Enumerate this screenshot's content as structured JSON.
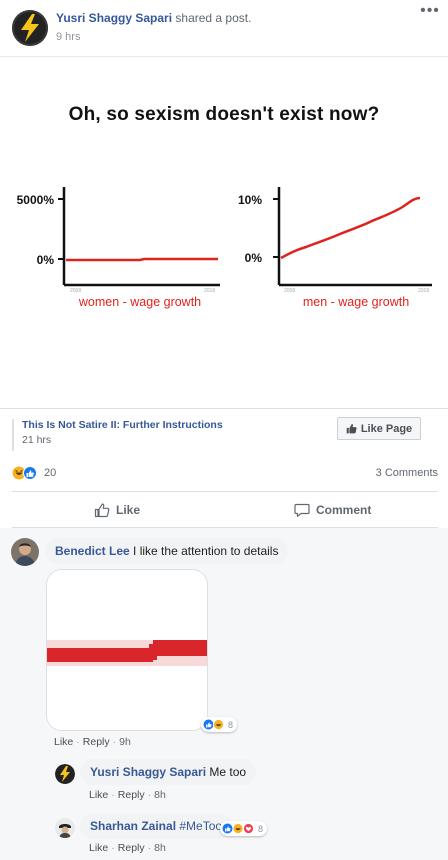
{
  "post": {
    "author": "Yusri Shaggy Sapari",
    "action": "shared a post.",
    "time": "9 hrs",
    "more_icon": "ellipsis-icon"
  },
  "meme": {
    "title": "Oh, so sexism doesn't exist now?",
    "left_chart": {
      "y_top_label": "5000%",
      "y_bottom_label": "0%",
      "x_start": "2008",
      "x_end": "2018",
      "caption": "women - wage growth",
      "line_color": "#e0221d"
    },
    "right_chart": {
      "y_top_label": "10%",
      "y_bottom_label": "0%",
      "x_start": "2008",
      "x_end": "2018",
      "caption": "men - wage growth",
      "line_color": "#e0221d"
    }
  },
  "shared_from": {
    "page_name": "This Is Not Satire II: Further Instructions",
    "time": "21 hrs",
    "like_page_label": "Like Page"
  },
  "reactions": {
    "count": "20",
    "comments_label": "3 Comments",
    "icons": [
      "haha-icon",
      "like-icon"
    ]
  },
  "actions": {
    "like_label": "Like",
    "comment_label": "Comment"
  },
  "comments": [
    {
      "name": "Benedict Lee",
      "text": "I like the attention to details",
      "reaction_count": "8",
      "like": "Like",
      "reply": "Reply",
      "time": "9h"
    },
    {
      "name": "Yusri Shaggy Sapari",
      "text": "Me too",
      "like": "Like",
      "reply": "Reply",
      "time": "8h"
    },
    {
      "name": "Sharhan Zainal",
      "text": "#MeToo",
      "reaction_count": "8",
      "like": "Like",
      "reply": "Reply",
      "time": "8h"
    }
  ],
  "colors": {
    "link_blue": "#365899",
    "meta_gray": "#606770",
    "line_red": "#e0221d",
    "like_blue": "#1877f2",
    "haha_yellow": "#f7b125"
  }
}
